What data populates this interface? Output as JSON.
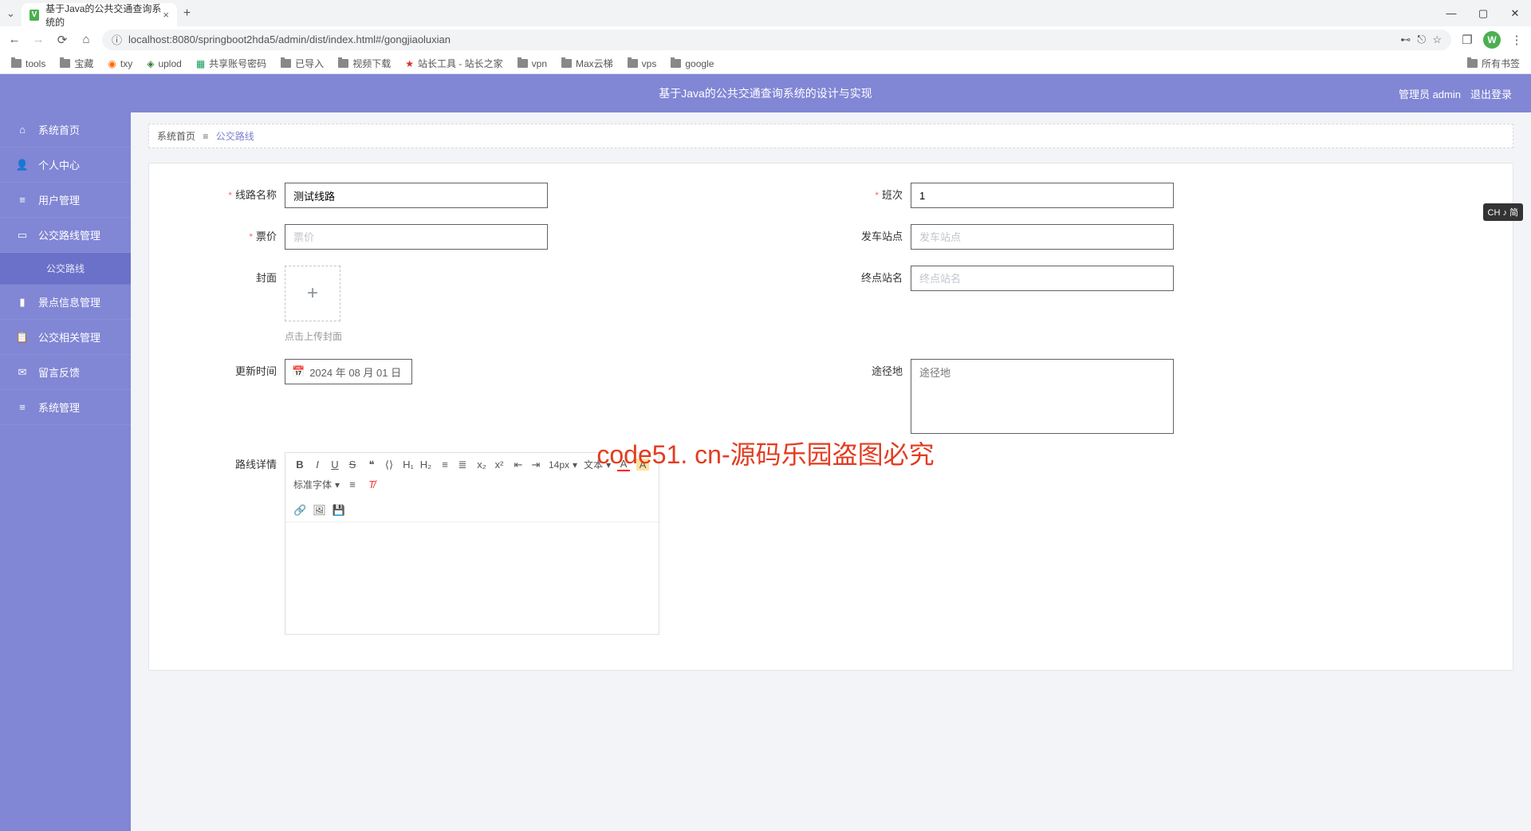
{
  "browser": {
    "tab_title": "基于Java的公共交通查询系统的",
    "url": "localhost:8080/springboot2hda5/admin/dist/index.html#/gongjiaoluxian",
    "user_badge": "W",
    "bookmarks": [
      "tools",
      "宝藏",
      "txy",
      "uplod",
      "共享账号密码",
      "已导入",
      "视频下载",
      "站长工具 - 站长之家",
      "vpn",
      "Max云梯",
      "vps",
      "google"
    ],
    "all_bookmarks": "所有书签"
  },
  "app": {
    "title": "基于Java的公共交通查询系统的设计与实现",
    "admin_label": "管理员 admin",
    "logout": "退出登录"
  },
  "sidebar": {
    "items": [
      {
        "icon": "home",
        "label": "系统首页"
      },
      {
        "icon": "person",
        "label": "个人中心"
      },
      {
        "icon": "list",
        "label": "用户管理"
      },
      {
        "icon": "chat",
        "label": "公交路线管理"
      },
      {
        "icon": "",
        "label": "公交路线",
        "selected": true
      },
      {
        "icon": "marker",
        "label": "景点信息管理"
      },
      {
        "icon": "clip",
        "label": "公交相关管理"
      },
      {
        "icon": "msg",
        "label": "留言反馈"
      },
      {
        "icon": "list",
        "label": "系统管理"
      }
    ]
  },
  "breadcrumb": {
    "home": "系统首页",
    "sep": "≡",
    "current": "公交路线"
  },
  "form": {
    "route_name": {
      "label": "线路名称",
      "value": "测试线路"
    },
    "frequency": {
      "label": "班次",
      "value": "1"
    },
    "price": {
      "label": "票价",
      "placeholder": "票价",
      "value": ""
    },
    "depart": {
      "label": "发车站点",
      "placeholder": "发车站点",
      "value": ""
    },
    "terminal": {
      "label": "终点站名",
      "placeholder": "终点站名",
      "value": ""
    },
    "cover": {
      "label": "封面",
      "hint": "点击上传封面"
    },
    "update_time": {
      "label": "更新时间",
      "value": "2024 年 08 月 01 日"
    },
    "via": {
      "label": "途径地",
      "placeholder": "途径地",
      "value": ""
    },
    "detail": {
      "label": "路线详情"
    }
  },
  "editor": {
    "font_size": "14px",
    "heading": "文本",
    "font_family": "标准字体"
  },
  "watermark": "code51. cn-源码乐园盗图必究",
  "ime": "CH ♪ 简"
}
